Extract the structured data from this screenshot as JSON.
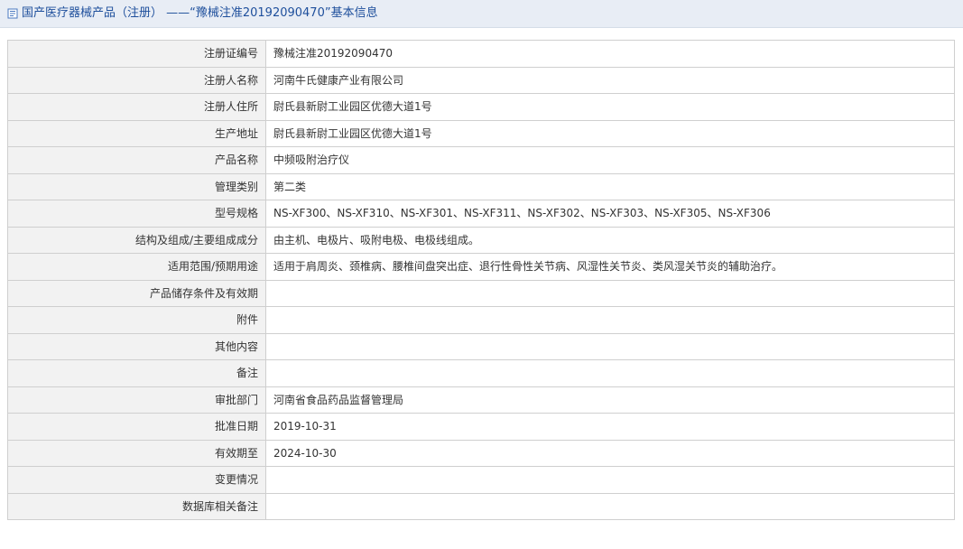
{
  "header": {
    "title": "国产医疗器械产品（注册） ——“豫械注准20192090470”基本信息"
  },
  "rows": [
    {
      "label": "注册证编号",
      "value": "豫械注准20192090470"
    },
    {
      "label": "注册人名称",
      "value": "河南牛氏健康产业有限公司"
    },
    {
      "label": "注册人住所",
      "value": "尉氏县新尉工业园区优德大道1号"
    },
    {
      "label": "生产地址",
      "value": "尉氏县新尉工业园区优德大道1号"
    },
    {
      "label": "产品名称",
      "value": "中频吸附治疗仪"
    },
    {
      "label": "管理类别",
      "value": "第二类"
    },
    {
      "label": "型号规格",
      "value": "NS-XF300、NS-XF310、NS-XF301、NS-XF311、NS-XF302、NS-XF303、NS-XF305、NS-XF306"
    },
    {
      "label": "结构及组成/主要组成成分",
      "value": "由主机、电极片、吸附电极、电极线组成。"
    },
    {
      "label": "适用范围/预期用途",
      "value": "适用于肩周炎、颈椎病、腰椎间盘突出症、退行性骨性关节病、风湿性关节炎、类风湿关节炎的辅助治疗。"
    },
    {
      "label": "产品储存条件及有效期",
      "value": ""
    },
    {
      "label": "附件",
      "value": ""
    },
    {
      "label": "其他内容",
      "value": ""
    },
    {
      "label": "备注",
      "value": ""
    },
    {
      "label": "审批部门",
      "value": "河南省食品药品监督管理局"
    },
    {
      "label": "批准日期",
      "value": "2019-10-31"
    },
    {
      "label": "有效期至",
      "value": "2024-10-30"
    },
    {
      "label": "变更情况",
      "value": ""
    },
    {
      "label": "数据库相关备注",
      "value": ""
    }
  ],
  "colors": {
    "header_bg": "#e8edf5",
    "header_text": "#1e4f9c",
    "label_bg": "#f2f2f2",
    "border": "#cfcfcf"
  }
}
